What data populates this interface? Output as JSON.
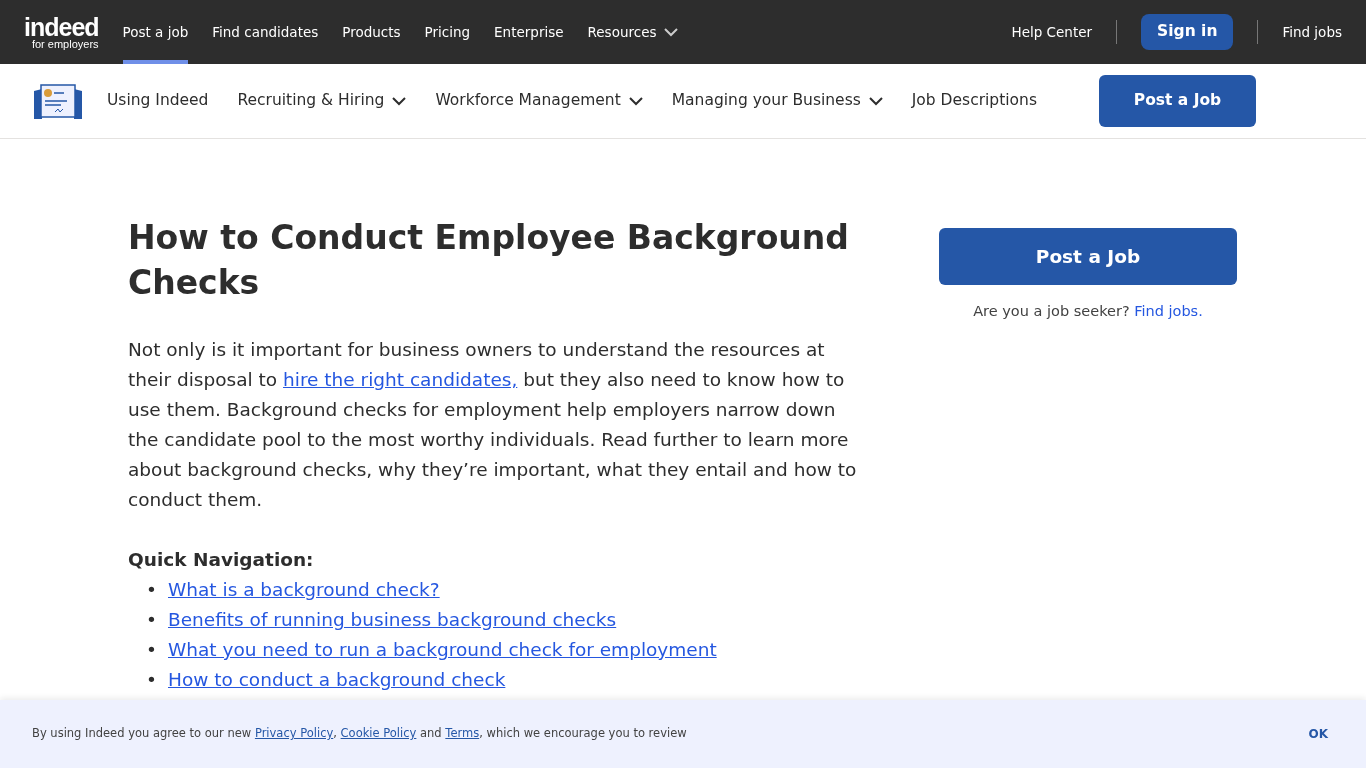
{
  "top_nav": {
    "logo": {
      "word": "indeed",
      "sub": "for employers"
    },
    "items": [
      {
        "label": "Post a job",
        "selected": true,
        "dropdown": false
      },
      {
        "label": "Find candidates",
        "selected": false,
        "dropdown": false
      },
      {
        "label": "Products",
        "selected": false,
        "dropdown": false
      },
      {
        "label": "Pricing",
        "selected": false,
        "dropdown": false
      },
      {
        "label": "Enterprise",
        "selected": false,
        "dropdown": false
      },
      {
        "label": "Resources",
        "selected": false,
        "dropdown": true
      }
    ],
    "help": "Help Center",
    "sign_in": "Sign in",
    "find_jobs": "Find jobs"
  },
  "sub_nav": {
    "items": [
      {
        "label": "Using Indeed",
        "dropdown": false
      },
      {
        "label": "Recruiting & Hiring",
        "dropdown": true
      },
      {
        "label": "Workforce Management",
        "dropdown": true
      },
      {
        "label": "Managing your Business",
        "dropdown": true
      },
      {
        "label": "Job Descriptions",
        "dropdown": false
      }
    ],
    "button": "Post a Job"
  },
  "article": {
    "title": "How to Conduct Employee Background Checks",
    "intro": {
      "before": "Not only is it important for business owners to understand the resources at their disposal to ",
      "link": "hire the right candidates,",
      "after": " but they also need to know how to use them. Background checks for employment help employers narrow down the candidate pool to the most worthy individuals. Read further to learn more about background checks, why they’re important, what they entail and how to conduct them."
    },
    "quick_nav_title": "Quick Navigation:",
    "quick_nav": [
      {
        "marker": "•",
        "label": "What is a background check?"
      },
      {
        "marker": "•",
        "label": "Benefits of running business background checks"
      },
      {
        "marker": "•",
        "label": "What you need to run a background check for employment"
      },
      {
        "marker": "•",
        "label": "How to conduct a background check"
      }
    ]
  },
  "sidebar": {
    "button": "Post a Job",
    "question": "Are you a job seeker?",
    "link": "Find jobs."
  },
  "cookie_banner": {
    "before": "By using Indeed you agree to our new ",
    "privacy": "Privacy Policy",
    "sep": ", ",
    "cookie": "Cookie Policy",
    "and": " and ",
    "terms": "Terms",
    "after": ", which we encourage you to review",
    "ok": "OK"
  }
}
